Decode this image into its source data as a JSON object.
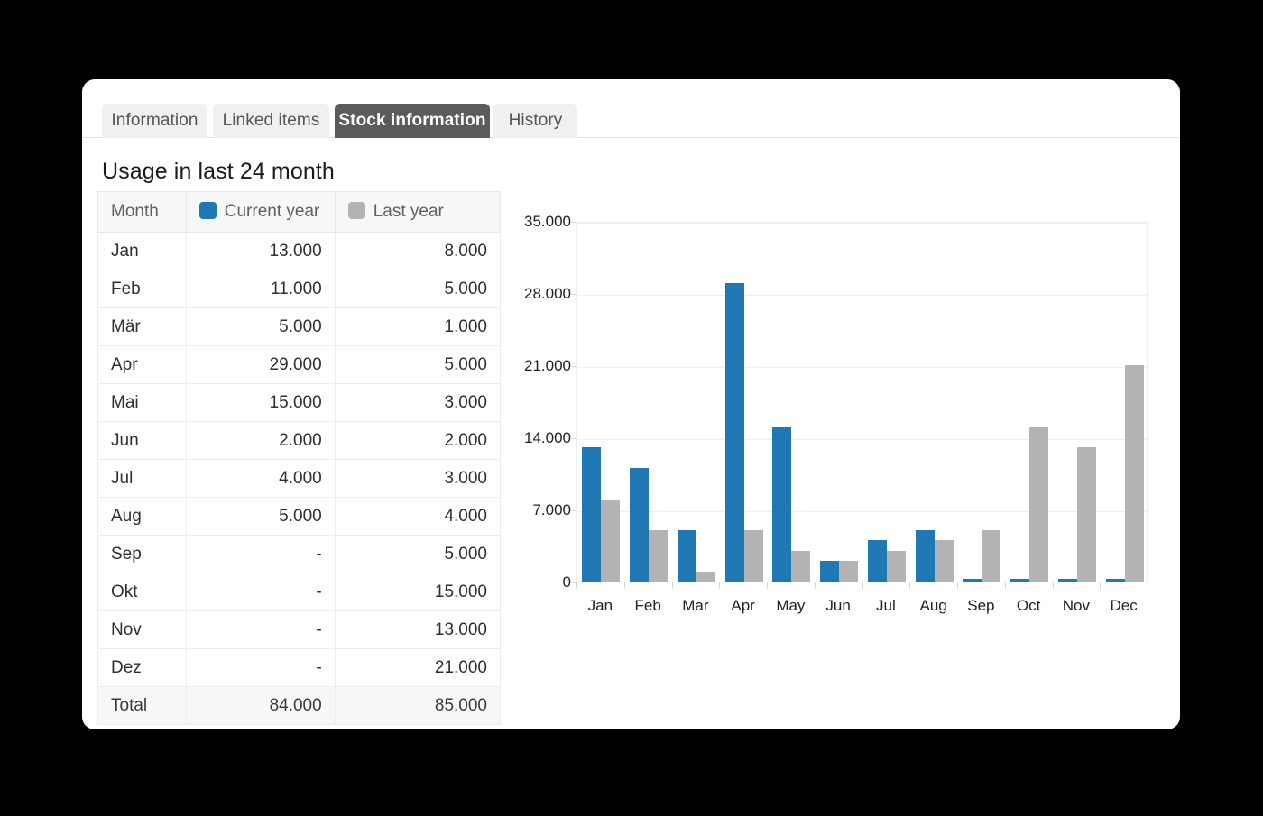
{
  "tabs": [
    {
      "label": "Information",
      "active": false
    },
    {
      "label": "Linked items",
      "active": false
    },
    {
      "label": "Stock information",
      "active": true
    },
    {
      "label": "History",
      "active": false
    }
  ],
  "panel": {
    "title": "Usage in last 24 month"
  },
  "table": {
    "headers": {
      "month": "Month",
      "current_year": "Current year",
      "last_year": "Last year"
    },
    "rows": [
      {
        "month": "Jan",
        "current": "13.000",
        "last": "8.000"
      },
      {
        "month": "Feb",
        "current": "11.000",
        "last": "5.000"
      },
      {
        "month": "Mär",
        "current": "5.000",
        "last": "1.000"
      },
      {
        "month": "Apr",
        "current": "29.000",
        "last": "5.000"
      },
      {
        "month": "Mai",
        "current": "15.000",
        "last": "3.000"
      },
      {
        "month": "Jun",
        "current": "2.000",
        "last": "2.000"
      },
      {
        "month": "Jul",
        "current": "4.000",
        "last": "3.000"
      },
      {
        "month": "Aug",
        "current": "5.000",
        "last": "4.000"
      },
      {
        "month": "Sep",
        "current": "-",
        "last": "5.000"
      },
      {
        "month": "Okt",
        "current": "-",
        "last": "15.000"
      },
      {
        "month": "Nov",
        "current": "-",
        "last": "13.000"
      },
      {
        "month": "Dez",
        "current": "-",
        "last": "21.000"
      }
    ],
    "total": {
      "month": "Total",
      "current": "84.000",
      "last": "85.000"
    }
  },
  "colors": {
    "current_year": "#1f78b4",
    "last_year": "#b3b3b3",
    "active_tab_bg": "#5b5b5b",
    "tab_bg": "#f0f0f0"
  },
  "chart_data": {
    "type": "bar",
    "title": "Usage in last 24 month",
    "xlabel": "",
    "ylabel": "",
    "categories": [
      "Jan",
      "Feb",
      "Mar",
      "Apr",
      "May",
      "Jun",
      "Jul",
      "Aug",
      "Sep",
      "Oct",
      "Nov",
      "Dec"
    ],
    "series": [
      {
        "name": "Current year",
        "color": "#1f78b4",
        "values": [
          13000,
          11000,
          5000,
          29000,
          15000,
          2000,
          4000,
          5000,
          0,
          0,
          0,
          0
        ]
      },
      {
        "name": "Last year",
        "color": "#b3b3b3",
        "values": [
          8000,
          5000,
          1000,
          5000,
          3000,
          2000,
          3000,
          4000,
          5000,
          15000,
          13000,
          21000
        ]
      }
    ],
    "ylim": [
      0,
      35000
    ],
    "yticks": [
      0,
      7000,
      14000,
      21000,
      28000,
      35000
    ],
    "ytick_labels": [
      "0",
      "7.000",
      "14.000",
      "21.000",
      "28.000",
      "35.000"
    ],
    "grid": true,
    "legend": "in table header"
  }
}
